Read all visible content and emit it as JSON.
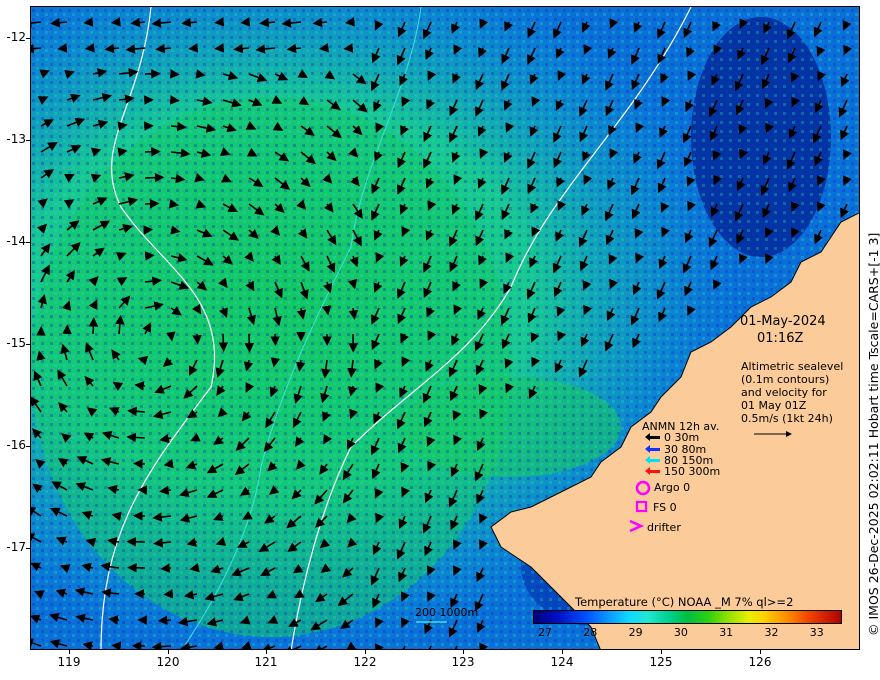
{
  "map": {
    "date": "01-May-2024",
    "time": "01:16Z",
    "note_lines": [
      "Altimetric sealevel",
      "(0.1m contours)",
      "and velocity for",
      "01 May 01Z",
      "0.5m/s (1kt 24h)"
    ],
    "y_ticks": [
      "-12",
      "-13",
      "-14",
      "-15",
      "-16",
      "-17"
    ],
    "x_ticks": [
      "119",
      "120",
      "121",
      "122",
      "123",
      "124",
      "125",
      "126"
    ],
    "credit": "© IMOS 26-Dec-2025 02:02:11 Hobart time Tscale=CARS+[-1 3]",
    "legend": {
      "title": "ANMN 12h av.",
      "rows": [
        {
          "label": "0 30m",
          "color": "#000000"
        },
        {
          "label": "30 80m",
          "color": "#1030ff"
        },
        {
          "label": "80 150m",
          "color": "#00e0f0"
        },
        {
          "label": "150 300m",
          "color": "#ff1010"
        }
      ],
      "argo": "Argo 0",
      "fs": "FS 0",
      "drifter": "drifter",
      "marker_color": "#ff00ff"
    },
    "isobath_label": "200  1000m",
    "colorbar": {
      "title": "Temperature (°C) NOAA _M 7% ql>=2",
      "ticks": [
        "27",
        "28",
        "29",
        "30",
        "31",
        "32",
        "33"
      ]
    },
    "colors": {
      "land": "#fbcb99",
      "ocean_warm": "#10c860",
      "ocean_cool": "#0a6fd8",
      "contour": "#ffffff",
      "isobath": "#40e0e0"
    }
  }
}
